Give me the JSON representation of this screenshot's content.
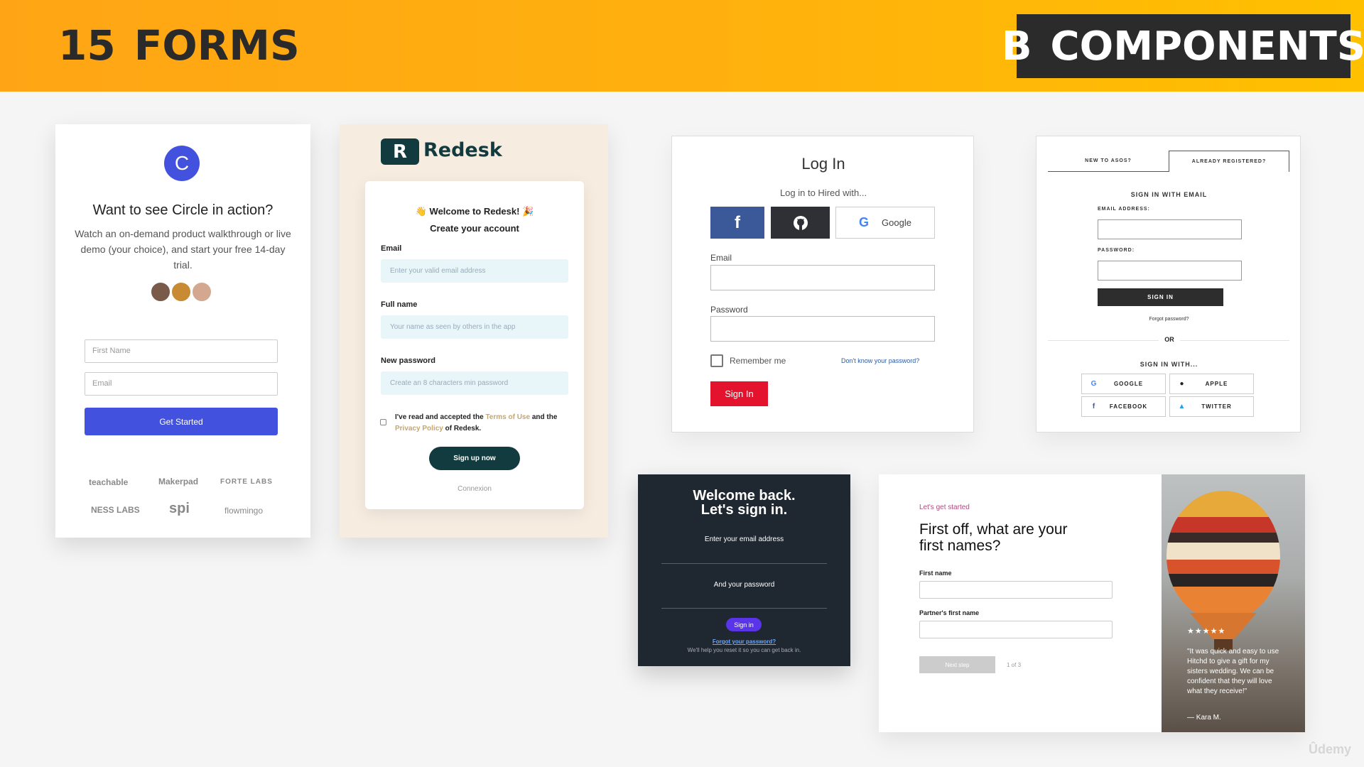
{
  "header": {
    "number": "15",
    "title": "FORMS",
    "section_letter": "B",
    "section_title": "COMPONENTS"
  },
  "colors": {
    "header_yellow": "#ffb10d",
    "circle_blue": "#4352de",
    "redesk_teal": "#123b40",
    "hired_red": "#e3132d",
    "facebook_blue": "#3b5998",
    "dark_bg": "#1f2730",
    "sign_in_purple": "#5a34e8",
    "hitchd_pink": "#b04a80"
  },
  "circle": {
    "logo_letter": "C",
    "heading": "Want to see Circle in action?",
    "description": "Watch an on-demand product walkthrough or live demo (your choice), and start your free 14-day trial.",
    "first_name_placeholder": "First Name",
    "email_placeholder": "Email",
    "button": "Get Started",
    "logos": [
      "teachable",
      "Makerpad",
      "FORTE LABS",
      "NESS LABS",
      "spi",
      "flowmingo"
    ]
  },
  "redesk": {
    "brand": "Redesk",
    "welcome": "👋 Welcome to Redesk! 🎉",
    "subtitle": "Create your account",
    "email_label": "Email",
    "email_placeholder": "Enter your valid email address",
    "fullname_label": "Full name",
    "fullname_placeholder": "Your name as seen by others in the app",
    "password_label": "New password",
    "password_placeholder": "Create an 8 characters min password",
    "terms_before": "I've read and accepted the ",
    "terms_link": "Terms of Use",
    "terms_middle": " and the ",
    "privacy_link": "Privacy Policy",
    "terms_after": " of Redesk.",
    "button": "Sign up now",
    "alt_link": "Connexion"
  },
  "hired": {
    "title": "Log In",
    "subtitle": "Log in to Hired with...",
    "google": "Google",
    "email_label": "Email",
    "password_label": "Password",
    "remember": "Remember me",
    "forgot": "Don't know your password?",
    "button": "Sign In"
  },
  "asos": {
    "tab_new": "NEW TO ASOS?",
    "tab_registered": "ALREADY REGISTERED?",
    "heading": "SIGN IN WITH EMAIL",
    "email_label": "EMAIL ADDRESS:",
    "password_label": "PASSWORD:",
    "button": "SIGN IN",
    "forgot": "Forgot password?",
    "or": "OR",
    "with_heading": "SIGN IN WITH...",
    "google": "GOOGLE",
    "apple": "APPLE",
    "facebook": "FACEBOOK",
    "twitter": "TWITTER"
  },
  "dark": {
    "title_line1": "Welcome back.",
    "title_line2": "Let's sign in.",
    "email_prompt": "Enter your email address",
    "password_prompt": "And your password",
    "button": "Sign in",
    "forgot": "Forgot your password?",
    "help": "We'll help you reset it so you can get back in."
  },
  "hitchd": {
    "kicker": "Let's get started",
    "heading": "First off, what are your first names?",
    "first_name_label": "First name",
    "partner_label": "Partner's first name",
    "button": "Next step",
    "step": "1 of 3",
    "stars": "★★★★★",
    "quote": "\"It was quick and easy to use Hitchd to give a gift for my sisters wedding. We can be confident that they will love what they receive!\"",
    "author": "— Kara M."
  },
  "watermark": "Ûdemy"
}
